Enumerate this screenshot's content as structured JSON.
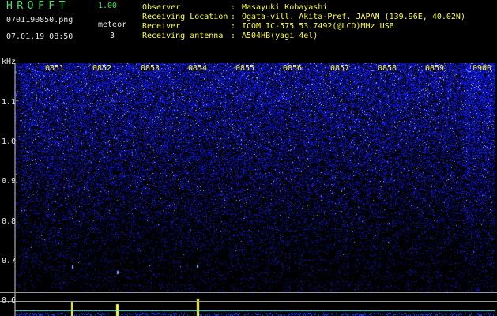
{
  "header": {
    "app_title": "HROFFT",
    "app_version": "1.00",
    "filename": "0701190850.png",
    "datetime": "07.01.19 08:50",
    "meteor_label": "meteor",
    "meteor_count": "3"
  },
  "info": {
    "observer_label": "Observer",
    "observer_value": "Masayuki Kobayashi",
    "location_label": "Receiving Location",
    "location_value": "Ogata-vill. Akita-Pref. JAPAN (139.96E, 40.02N)",
    "receiver_label": "Receiver",
    "receiver_value": "ICOM IC-575 53.7492(@LCD)MHz USB",
    "antenna_label": "Receiving antenna",
    "antenna_value": "A504HB(yagi 4el)",
    "separator": ":"
  },
  "axis": {
    "unit": "kHz",
    "y_labels": [
      "1.1",
      "1.0",
      "0.9",
      "0.8",
      "0.7",
      "0.6"
    ],
    "time_labels": [
      "0851",
      "0852",
      "0853",
      "0854",
      "0855",
      "0856",
      "0857",
      "0858",
      "0859",
      "0900"
    ]
  },
  "colors": {
    "title_green": "#46e05a",
    "time_yellow": "#ffff3a",
    "noise_blue": "#1a2aa8",
    "background": "#000000"
  }
}
